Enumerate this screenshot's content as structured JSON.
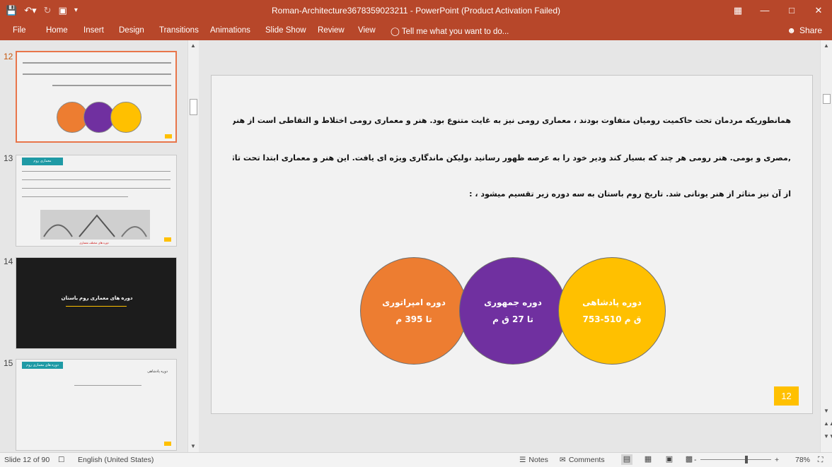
{
  "titlebar": {
    "title": "Roman-Architecture3678359023211 - PowerPoint (Product Activation Failed)",
    "qat_icons": [
      "save-icon",
      "undo-icon",
      "redo-icon",
      "start-from-beginning-icon",
      "customize-qat-icon"
    ]
  },
  "ribbon": {
    "tabs": [
      "File",
      "Home",
      "Insert",
      "Design",
      "Transitions",
      "Animations",
      "Slide Show",
      "Review",
      "View"
    ],
    "tell_me": "Tell me what you want to do...",
    "share": "Share"
  },
  "thumbnails": [
    {
      "number": "12",
      "active": true
    },
    {
      "number": "13",
      "title": "معماری روم",
      "caption": "دوره های مختلف معماری"
    },
    {
      "number": "14",
      "title": "دوره های معماری روم باستان"
    },
    {
      "number": "15",
      "title": "دوره های معماری روم",
      "subtitle": "دوره پادشاهی"
    }
  ],
  "slide": {
    "paragraph_lines": [
      "همانطوریکه مردمان تحت حاکمیت رومیان متفاوت بودند ، معماری رومی نیز به غایت متنوع بود. هنر و معماری رومی اختلاط و التقاطی است از هنر اتروسکی ،یونانی ، آسیای غربی",
      ",مصری و بومی. هنر رومی هر چند که بسیار کند ودیر خود را به عرصه ظهور رسانید ،ولیکن ماندگاری ویژه ای یافت. این هنر و معماری ابتدا تحت تاثیر هنر و معماری اتروسکی و پس",
      "از آن نیز متاثر از هنر یونانی شد. تاریخ روم باستان به سه دوره زیر تقسیم میشود ، :"
    ],
    "circles": [
      {
        "title": "دوره امپراتوری",
        "subtitle": "تا 395 م",
        "color": "#ed7d31"
      },
      {
        "title": "دوره جمهوری",
        "subtitle": "تا 27 ق م",
        "color": "#7030a0"
      },
      {
        "title": "دوره پادشاهی",
        "subtitle": "753-510 ق م",
        "color": "#ffc000"
      }
    ],
    "page_number": "12"
  },
  "statusbar": {
    "slide_info": "Slide 12 of 90",
    "language": "English (United States)",
    "notes": "Notes",
    "comments": "Comments",
    "zoom_minus": "-",
    "zoom_plus": "+",
    "zoom": "78%"
  },
  "colors": {
    "ribbon": "#b7472a",
    "accent_orange": "#ed7d31",
    "accent_purple": "#7030a0",
    "accent_gold": "#ffc000"
  }
}
